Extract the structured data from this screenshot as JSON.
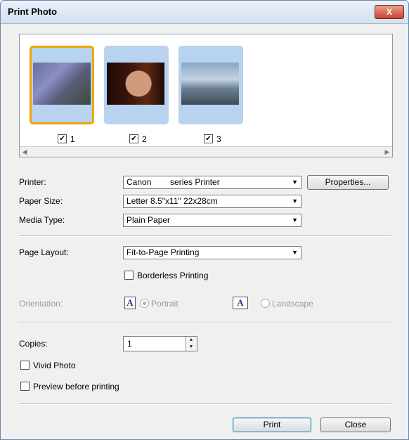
{
  "window": {
    "title": "Print Photo",
    "close_label": "X"
  },
  "photos": [
    {
      "number": "1",
      "checked": true,
      "selected": true
    },
    {
      "number": "2",
      "checked": true,
      "selected": false
    },
    {
      "number": "3",
      "checked": true,
      "selected": false
    }
  ],
  "printer": {
    "label": "Printer:",
    "value": "Canon        series Printer",
    "properties_label": "Properties..."
  },
  "paper_size": {
    "label": "Paper Size:",
    "value": "Letter 8.5\"x11\" 22x28cm"
  },
  "media_type": {
    "label": "Media Type:",
    "value": "Plain Paper"
  },
  "page_layout": {
    "label": "Page Layout:",
    "value": "Fit-to-Page Printing"
  },
  "borderless": {
    "label": "Borderless Printing",
    "checked": false
  },
  "orientation": {
    "label": "Orientation:",
    "icon_letter": "A",
    "portrait_label": "Portrait",
    "landscape_label": "Landscape",
    "selected": "Portrait"
  },
  "copies": {
    "label": "Copies:",
    "value": "1"
  },
  "vivid_photo": {
    "label": "Vivid Photo",
    "checked": false
  },
  "preview": {
    "label": "Preview before printing",
    "checked": false
  },
  "buttons": {
    "print": "Print",
    "close": "Close"
  },
  "icons": [
    "close-icon",
    "scroll-left-icon",
    "scroll-right-icon",
    "dropdown-arrow-icon",
    "orientation-portrait-icon",
    "orientation-landscape-icon",
    "spin-up-icon",
    "spin-down-icon"
  ]
}
